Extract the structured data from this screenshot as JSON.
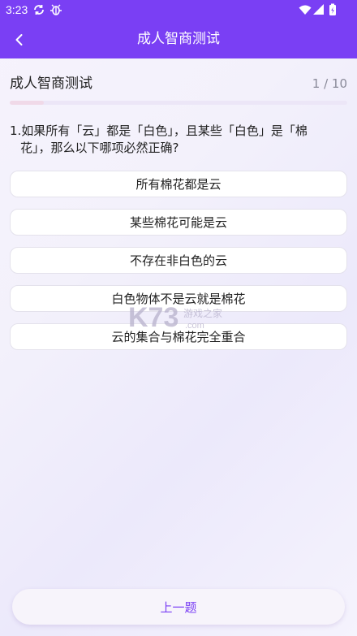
{
  "status_bar": {
    "time": "3:23",
    "icons": [
      "sync-icon",
      "bug-icon",
      "wifi-icon",
      "signal-icon",
      "battery-icon"
    ]
  },
  "nav": {
    "title": "成人智商测试",
    "back_icon": "chevron-left-icon"
  },
  "quiz": {
    "name": "成人智商测试",
    "progress_text": "1 / 10",
    "progress_fraction": 0.1
  },
  "question": {
    "line1": "1.如果所有「云」都是「白色」，且某些「白色」是「棉",
    "line2": "花」，那么以下哪项必然正确?"
  },
  "options": [
    "所有棉花都是云",
    "某些棉花可能是云",
    "不存在非白色的云",
    "白色物体不是云就是棉花",
    "云的集合与棉花完全重合"
  ],
  "footer": {
    "prev_label": "上一题"
  },
  "colors": {
    "accent": "#7a3ff4",
    "header_text": "#ffffff",
    "progress_fill": "#f0d9e8"
  }
}
